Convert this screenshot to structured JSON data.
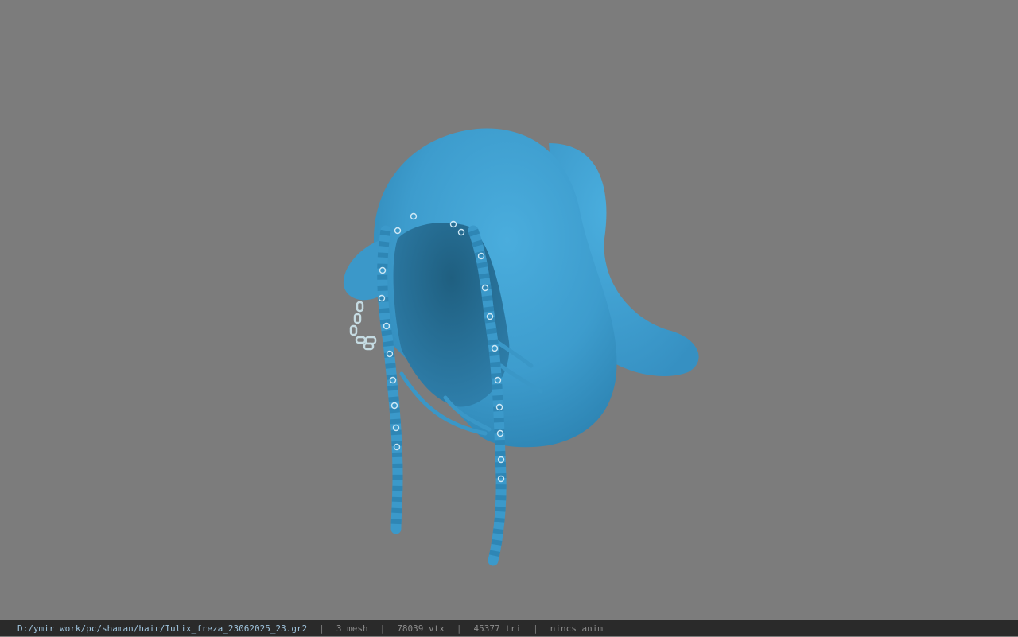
{
  "viewer": {
    "background_color": "#7c7c7c",
    "model_color": "#3f9fd0"
  },
  "statusbar": {
    "file_path": "D:/ymir work/pc/shaman/hair/Iulix_freza_23062025_23.gr2",
    "mesh_count": "3 mesh",
    "vertex_count": "78039 vtx",
    "triangle_count": "45377 tri",
    "anim_status": "nincs anim",
    "separator": "|"
  }
}
